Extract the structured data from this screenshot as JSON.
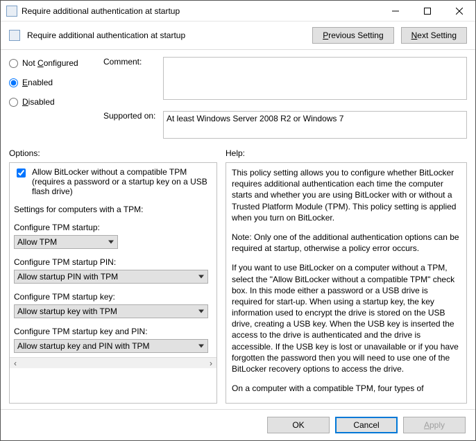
{
  "window": {
    "title": "Require additional authentication at startup"
  },
  "header": {
    "title": "Require additional authentication at startup",
    "prev": "Previous Setting",
    "next": "Next Setting"
  },
  "state": {
    "not_configured": "Not Configured",
    "enabled": "Enabled",
    "disabled": "Disabled",
    "selected": "enabled"
  },
  "comment": {
    "label": "Comment:",
    "value": ""
  },
  "supported": {
    "label": "Supported on:",
    "value": "At least Windows Server 2008 R2 or Windows 7"
  },
  "options": {
    "label": "Options:",
    "allow_no_tpm": {
      "label": "Allow BitLocker without a compatible TPM (requires a password or a startup key on a USB flash drive)",
      "checked": true
    },
    "tpm_heading": "Settings for computers with a TPM:",
    "tpm_startup": {
      "label": "Configure TPM startup:",
      "value": "Allow TPM"
    },
    "tpm_pin": {
      "label": "Configure TPM startup PIN:",
      "value": "Allow startup PIN with TPM"
    },
    "tpm_key": {
      "label": "Configure TPM startup key:",
      "value": "Allow startup key with TPM"
    },
    "tpm_keypin": {
      "label": "Configure TPM startup key and PIN:",
      "value": "Allow startup key and PIN with TPM"
    }
  },
  "help": {
    "label": "Help:",
    "p1": "This policy setting allows you to configure whether BitLocker requires additional authentication each time the computer starts and whether you are using BitLocker with or without a Trusted Platform Module (TPM). This policy setting is applied when you turn on BitLocker.",
    "p2": "Note: Only one of the additional authentication options can be required at startup, otherwise a policy error occurs.",
    "p3": "If you want to use BitLocker on a computer without a TPM, select the \"Allow BitLocker without a compatible TPM\" check box. In this mode either a password or a USB drive is required for start-up. When using a startup key, the key information used to encrypt the drive is stored on the USB drive, creating a USB key. When the USB key is inserted the access to the drive is authenticated and the drive is accessible. If the USB key is lost or unavailable or if you have forgotten the password then you will need to use one of the BitLocker recovery options to access the drive.",
    "p4": "On a computer with a compatible TPM, four types of"
  },
  "footer": {
    "ok": "OK",
    "cancel": "Cancel",
    "apply": "Apply"
  }
}
